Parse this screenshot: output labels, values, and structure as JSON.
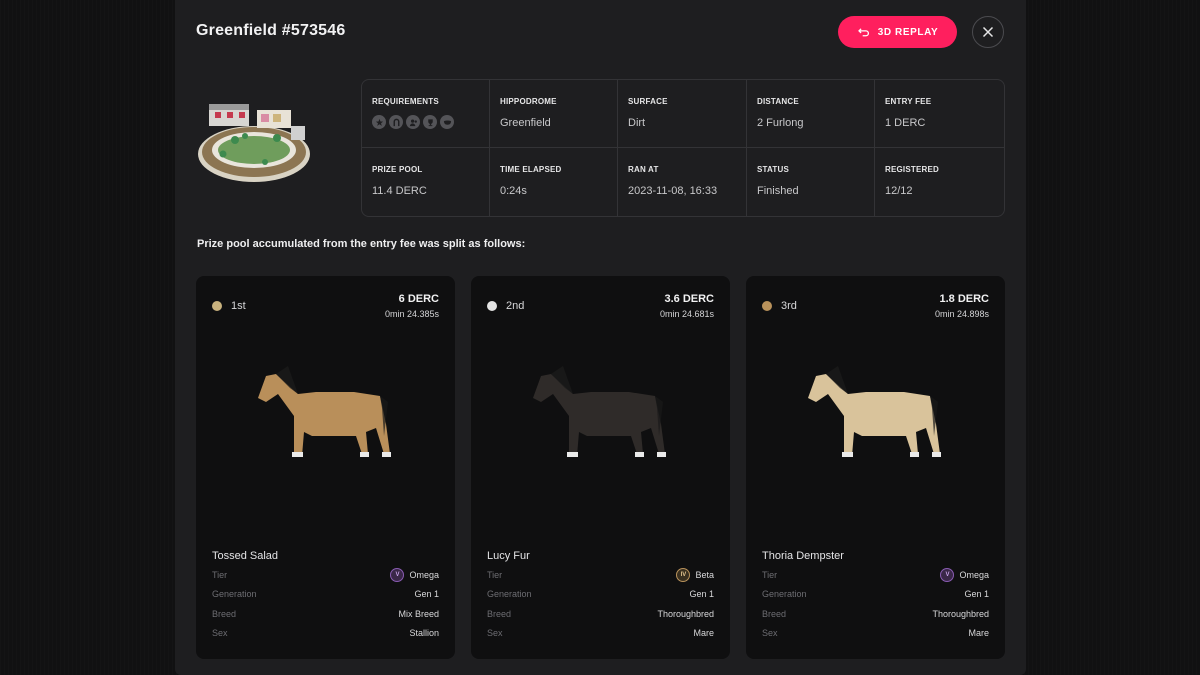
{
  "modal": {
    "title": "Greenfield #573546",
    "replay_label": "3D REPLAY"
  },
  "info": [
    {
      "label": "REQUIREMENTS",
      "value": "",
      "icons": [
        "star-icon",
        "horseshoe-icon",
        "user-group-icon",
        "trophy-icon",
        "mask-icon"
      ]
    },
    {
      "label": "HIPPODROME",
      "value": "Greenfield"
    },
    {
      "label": "SURFACE",
      "value": "Dirt"
    },
    {
      "label": "DISTANCE",
      "value": "2 Furlong"
    },
    {
      "label": "ENTRY FEE",
      "value": "1 DERC"
    },
    {
      "label": "PRIZE POOL",
      "value": "11.4 DERC"
    },
    {
      "label": "TIME ELAPSED",
      "value": "0:24s"
    },
    {
      "label": "RAN AT",
      "value": "2023-11-08, 16:33"
    },
    {
      "label": "STATUS",
      "value": "Finished"
    },
    {
      "label": "REGISTERED",
      "value": "12/12"
    }
  ],
  "split_text": "Prize pool accumulated from the entry fee was split as follows:",
  "attr_labels": {
    "tier": "Tier",
    "generation": "Generation",
    "breed": "Breed",
    "sex": "Sex"
  },
  "results": [
    {
      "place": "1st",
      "place_color": "#c9b27e",
      "prize": "6 DERC",
      "time": "0min 24.385s",
      "name": "Tossed Salad",
      "tier": "Omega",
      "tier_badge": "V",
      "generation": "Gen 1",
      "breed": "Mix Breed",
      "sex": "Stallion",
      "coat": "#b98f5a"
    },
    {
      "place": "2nd",
      "place_color": "#e4e4e4",
      "prize": "3.6 DERC",
      "time": "0min 24.681s",
      "name": "Lucy Fur",
      "tier": "Beta",
      "tier_badge": "IV",
      "generation": "Gen 1",
      "breed": "Thoroughbred",
      "sex": "Mare",
      "coat": "#2f2b29"
    },
    {
      "place": "3rd",
      "place_color": "#b9925b",
      "prize": "1.8 DERC",
      "time": "0min 24.898s",
      "name": "Thoria Dempster",
      "tier": "Omega",
      "tier_badge": "V",
      "generation": "Gen 1",
      "breed": "Thoroughbred",
      "sex": "Mare",
      "coat": "#d9c39b"
    }
  ]
}
